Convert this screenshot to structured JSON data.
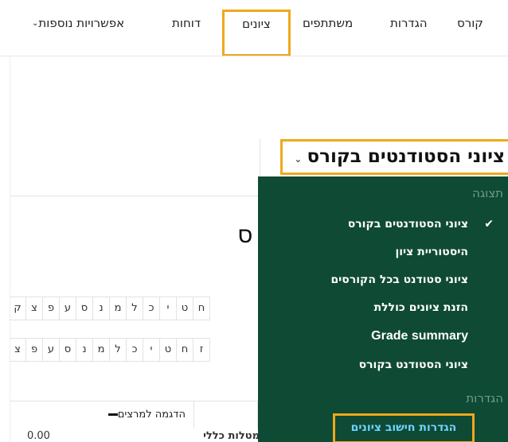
{
  "nav": {
    "items": [
      {
        "label": "קורס"
      },
      {
        "label": "הגדרות"
      },
      {
        "label": "משתתפים"
      },
      {
        "label": "ציונים"
      },
      {
        "label": "דוחות"
      },
      {
        "label": "אפשרויות נוספות"
      }
    ],
    "active": "ציונים"
  },
  "selector": {
    "label": "ציוני הסטודנטים בקורס"
  },
  "page": {
    "title_fragment": "ס"
  },
  "letters": {
    "row1": [
      "ח",
      "ט",
      "י",
      "כ",
      "ל",
      "מ",
      "נ",
      "ס",
      "ע",
      "פ",
      "צ",
      "ק"
    ],
    "row2": [
      "ז",
      "ח",
      "ט",
      "י",
      "כ",
      "ל",
      "מ",
      "נ",
      "ס",
      "ע",
      "פ",
      "צ"
    ]
  },
  "table": {
    "header_right": "",
    "header_left": "הדגמה למרצים",
    "row_right": "מטלות כללי",
    "row_left": "0.00"
  },
  "menu": {
    "groups": [
      {
        "title": "תצוגה",
        "items": [
          {
            "label": "ציוני הסטודנטים בקורס",
            "checked": true
          },
          {
            "label": "היסטוריית ציון"
          },
          {
            "label": "ציוני סטודנט בכל הקורסים"
          },
          {
            "label": "הזנת ציונים כוללת"
          },
          {
            "label": "Grade summary"
          },
          {
            "label": "ציוני הסטודנט בקורס"
          }
        ]
      },
      {
        "title": "הגדרות",
        "items": [
          {
            "label": "הגדרות חישוב ציונים",
            "highlighted": true
          }
        ]
      }
    ]
  },
  "colors": {
    "menu_bg": "#0f4a35",
    "highlight_border": "#f0a81c",
    "menu_highlight_text": "#6fd3ff"
  }
}
